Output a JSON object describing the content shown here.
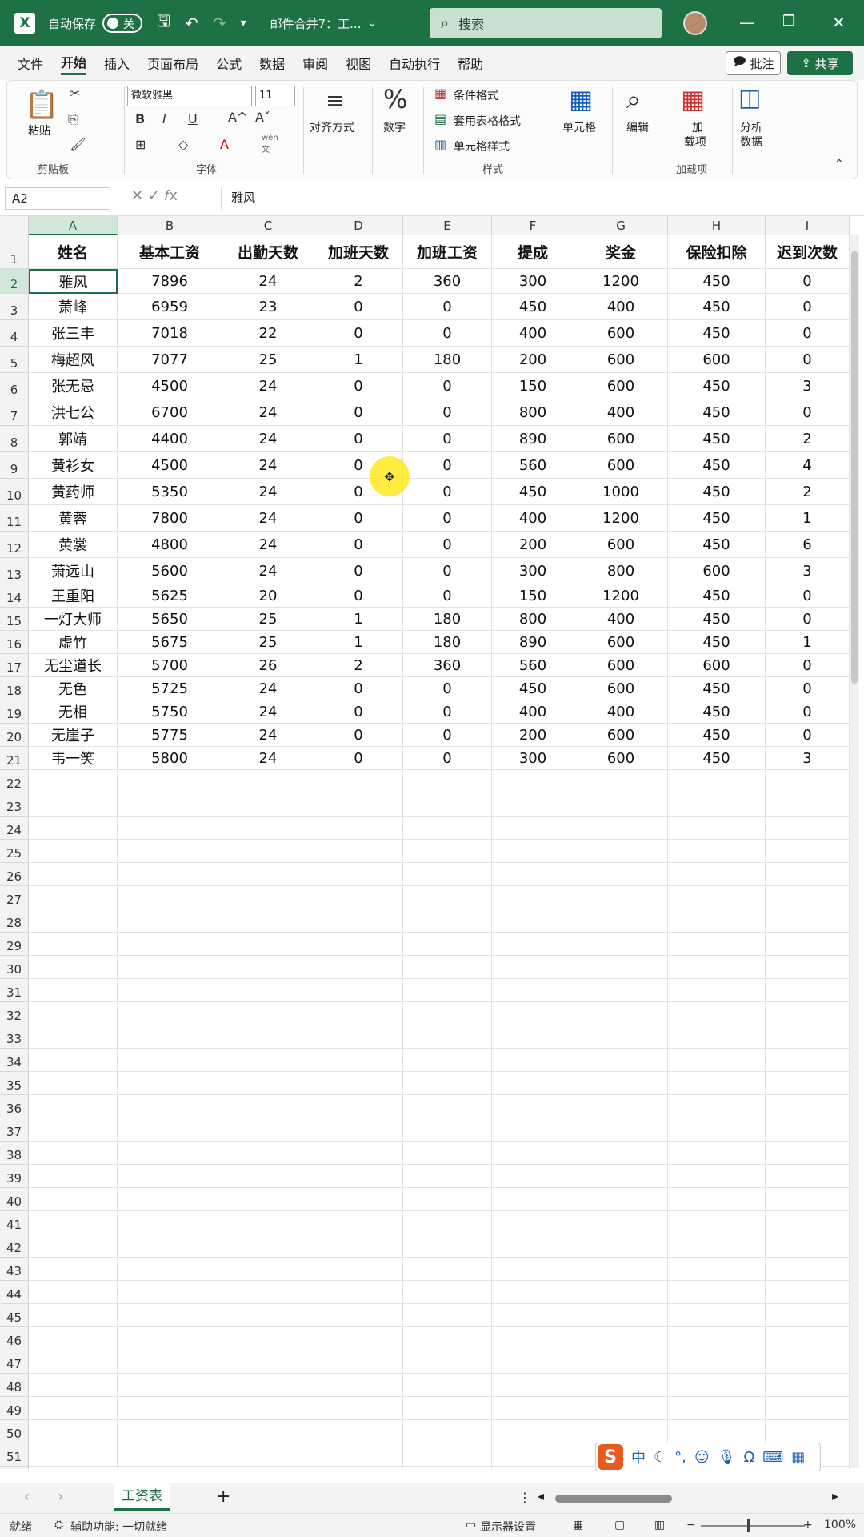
{
  "titlebar": {
    "autosave_label": "自动保存",
    "autosave_state": "关",
    "doc_title": "邮件合并7：工...",
    "search_placeholder": "搜索"
  },
  "menu": {
    "items": [
      "文件",
      "开始",
      "插入",
      "页面布局",
      "公式",
      "数据",
      "审阅",
      "视图",
      "自动执行",
      "帮助"
    ],
    "active": "开始",
    "comment_label": "批注",
    "share_label": "共享"
  },
  "ribbon": {
    "paste_label": "粘贴",
    "clipboard_group": "剪贴板",
    "font_name": "微软雅黑",
    "font_size": "11",
    "font_group": "字体",
    "align_label": "对齐方式",
    "number_label": "数字",
    "cond_format": "条件格式",
    "table_format": "套用表格格式",
    "cell_style": "单元格样式",
    "styles_group": "样式",
    "cells_label": "单元格",
    "edit_label": "编辑",
    "addin_label1": "加",
    "addin_label2": "载项",
    "addin_group": "加载项",
    "analyze_label1": "分析",
    "analyze_label2": "数据",
    "bold": "B",
    "italic": "I",
    "underline": "U",
    "grow_font": "A^",
    "shrink_font": "Aˇ",
    "wen": "wén",
    "wen_char": "文"
  },
  "formulabar": {
    "namebox": "A2",
    "content": "雅风"
  },
  "columns": [
    "A",
    "B",
    "C",
    "D",
    "E",
    "F",
    "G",
    "H",
    "I"
  ],
  "headers": [
    "姓名",
    "基本工资",
    "出勤天数",
    "加班天数",
    "加班工资",
    "提成",
    "奖金",
    "保险扣除",
    "迟到次数"
  ],
  "rows": [
    [
      "雅风",
      "7896",
      "24",
      "2",
      "360",
      "300",
      "1200",
      "450",
      "0"
    ],
    [
      "萧峰",
      "6959",
      "23",
      "0",
      "0",
      "450",
      "400",
      "450",
      "0"
    ],
    [
      "张三丰",
      "7018",
      "22",
      "0",
      "0",
      "400",
      "600",
      "450",
      "0"
    ],
    [
      "梅超风",
      "7077",
      "25",
      "1",
      "180",
      "200",
      "600",
      "600",
      "0"
    ],
    [
      "张无忌",
      "4500",
      "24",
      "0",
      "0",
      "150",
      "600",
      "450",
      "3"
    ],
    [
      "洪七公",
      "6700",
      "24",
      "0",
      "0",
      "800",
      "400",
      "450",
      "0"
    ],
    [
      "郭靖",
      "4400",
      "24",
      "0",
      "0",
      "890",
      "600",
      "450",
      "2"
    ],
    [
      "黄衫女",
      "4500",
      "24",
      "0",
      "0",
      "560",
      "600",
      "450",
      "4"
    ],
    [
      "黄药师",
      "5350",
      "24",
      "0",
      "0",
      "450",
      "1000",
      "450",
      "2"
    ],
    [
      "黄蓉",
      "7800",
      "24",
      "0",
      "0",
      "400",
      "1200",
      "450",
      "1"
    ],
    [
      "黄裳",
      "4800",
      "24",
      "0",
      "0",
      "200",
      "600",
      "450",
      "6"
    ],
    [
      "萧远山",
      "5600",
      "24",
      "0",
      "0",
      "300",
      "800",
      "600",
      "3"
    ],
    [
      "王重阳",
      "5625",
      "20",
      "0",
      "0",
      "150",
      "1200",
      "450",
      "0"
    ],
    [
      "一灯大师",
      "5650",
      "25",
      "1",
      "180",
      "800",
      "400",
      "450",
      "0"
    ],
    [
      "虚竹",
      "5675",
      "25",
      "1",
      "180",
      "890",
      "600",
      "450",
      "1"
    ],
    [
      "无尘道长",
      "5700",
      "26",
      "2",
      "360",
      "560",
      "600",
      "600",
      "0"
    ],
    [
      "无色",
      "5725",
      "24",
      "0",
      "0",
      "450",
      "600",
      "450",
      "0"
    ],
    [
      "无相",
      "5750",
      "24",
      "0",
      "0",
      "400",
      "400",
      "450",
      "0"
    ],
    [
      "无崖子",
      "5775",
      "24",
      "0",
      "0",
      "200",
      "600",
      "450",
      "0"
    ],
    [
      "韦一笑",
      "5800",
      "24",
      "0",
      "0",
      "300",
      "600",
      "450",
      "3"
    ]
  ],
  "row_count": 52,
  "sheet": {
    "tab_name": "工资表",
    "add_label": "+"
  },
  "ime": {
    "logo": "S",
    "mode": "中"
  },
  "status": {
    "ready": "就绪",
    "accessibility": "辅助功能: 一切就绪",
    "display_settings": "显示器设置",
    "zoom": "100%"
  },
  "colors": {
    "brand": "#1e7145",
    "active_cell": "#1e7145",
    "cursor_highlight": "#ffe600"
  }
}
